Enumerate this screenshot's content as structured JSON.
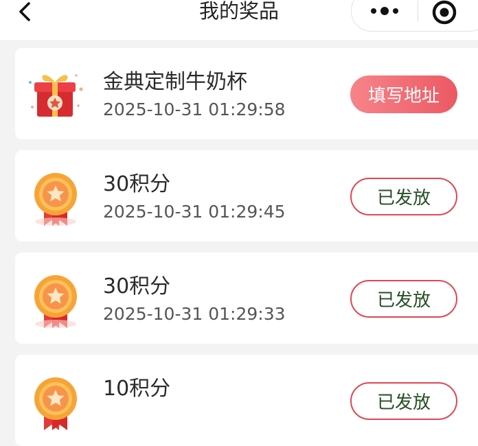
{
  "header": {
    "title": "我的奖品"
  },
  "colors": {
    "accent": "#ec5963",
    "outline_border": "#e04651",
    "outline_text": "#244e24",
    "background": "#f3f3f3"
  },
  "prizes": [
    {
      "name": "金典定制牛奶杯",
      "time": "2025-10-31 01:29:58",
      "action": "填写地址",
      "icon": "gift-box-icon",
      "button_style": "filled"
    },
    {
      "name": "30积分",
      "time": "2025-10-31 01:29:45",
      "action": "已发放",
      "icon": "medal-icon",
      "button_style": "outline"
    },
    {
      "name": "30积分",
      "time": "2025-10-31 01:29:33",
      "action": "已发放",
      "icon": "medal-icon",
      "button_style": "outline"
    },
    {
      "name": "10积分",
      "time": "",
      "action": "已发放",
      "icon": "medal-icon",
      "button_style": "outline"
    }
  ]
}
